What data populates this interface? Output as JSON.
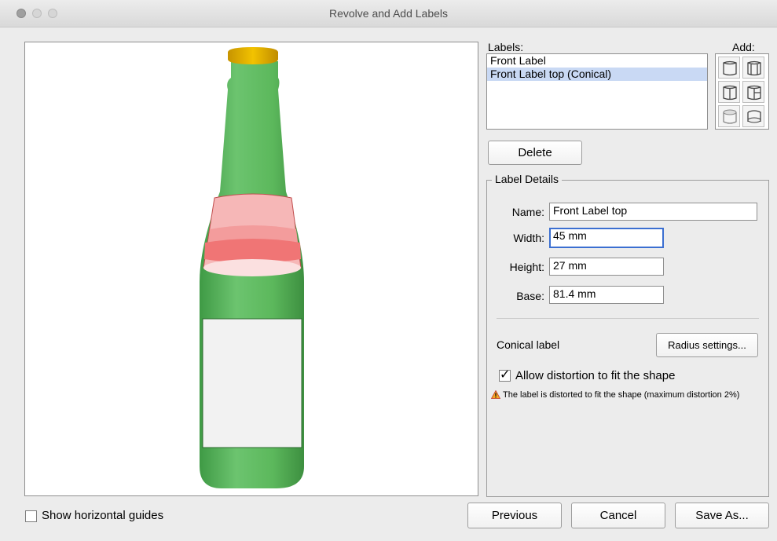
{
  "window": {
    "title": "Revolve and Add Labels"
  },
  "labels_panel": {
    "heading": "Labels:",
    "add_heading": "Add:",
    "items": [
      {
        "label": "Front Label",
        "selected": false
      },
      {
        "label": "Front Label top (Conical)",
        "selected": true
      }
    ],
    "add_buttons": [
      "cylinder-front-icon",
      "cylinder-wrap-icon",
      "cylinder-half-left-icon",
      "cylinder-half-right-icon",
      "cylinder-top-icon",
      "cylinder-bottom-icon"
    ],
    "delete_label": "Delete"
  },
  "label_details": {
    "legend": "Label Details",
    "name_label": "Name:",
    "name_value": "Front Label top",
    "width_label": "Width:",
    "width_value": "45 mm",
    "height_label": "Height:",
    "height_value": "27 mm",
    "base_label": "Base:",
    "base_value": "81.4 mm",
    "conical_label": "Conical label",
    "radius_button": "Radius settings...",
    "distortion_label": "Allow distortion to fit the shape",
    "distortion_checked": true,
    "warning_text": "The label is distorted to fit the shape (maximum distortion 2%)",
    "warning_icon": "warning-triangle-icon"
  },
  "footer": {
    "guides_label": "Show horizontal guides",
    "guides_checked": false,
    "previous": "Previous",
    "cancel": "Cancel",
    "save_as": "Save As..."
  },
  "colors": {
    "bottle_green": "#5cb85c",
    "cap_yellow": "#e8b100",
    "label_selected": "#f08080",
    "focus_blue": "#3b6fd1"
  }
}
